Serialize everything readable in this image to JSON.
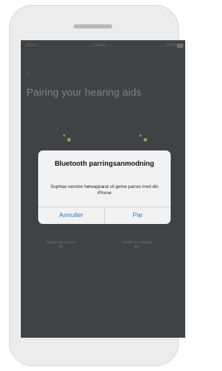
{
  "statusbar": {
    "time": "09:41",
    "carrier": "Carrier",
    "battery": "100%"
  },
  "page": {
    "back_icon": "‹",
    "title": "Pairing your hearing aids"
  },
  "hearing_aids": {
    "left_status": "System not hearing aid",
    "right_status": "System not hearing aid"
  },
  "dialog": {
    "title": "Bluetooth parringsanmodning",
    "message": "Sophias venstre høreapparat vil gerne parres med din iPhone",
    "cancel_label": "Annuller",
    "pair_label": "Par"
  },
  "colors": {
    "accent": "#2d7bd2",
    "hearing_aid_led": "#79b65a",
    "screen_dim": "#3f4345"
  }
}
